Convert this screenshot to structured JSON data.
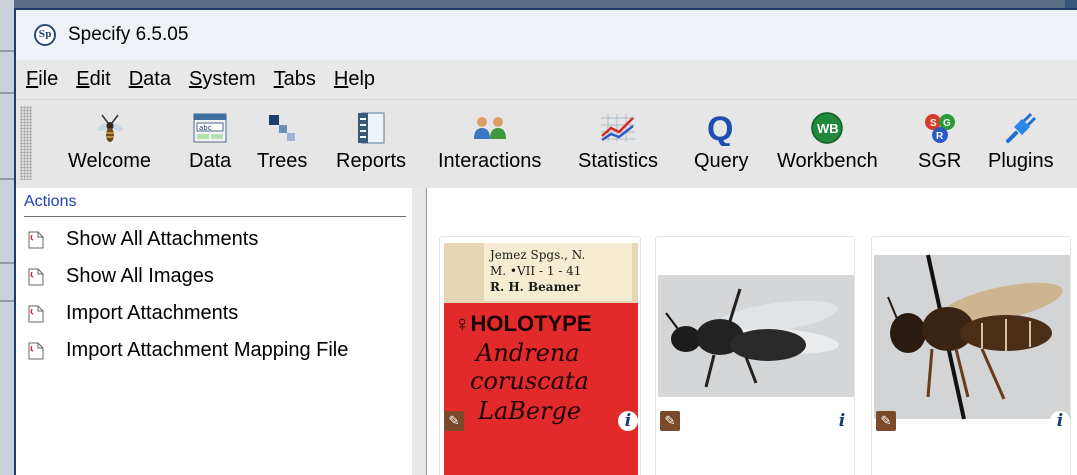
{
  "window": {
    "title": "Specify 6.5.05",
    "logo_text": "Sp"
  },
  "menu": [
    {
      "label": "File"
    },
    {
      "label": "Edit"
    },
    {
      "label": "Data"
    },
    {
      "label": "System"
    },
    {
      "label": "Tabs"
    },
    {
      "label": "Help"
    }
  ],
  "toolbar": [
    {
      "label": "Welcome",
      "icon": "bee-icon"
    },
    {
      "label": "Data",
      "icon": "form-icon"
    },
    {
      "label": "Trees",
      "icon": "tree-icon"
    },
    {
      "label": "Reports",
      "icon": "report-icon"
    },
    {
      "label": "Interactions",
      "icon": "people-icon"
    },
    {
      "label": "Statistics",
      "icon": "chart-icon"
    },
    {
      "label": "Query",
      "icon": "query-icon"
    },
    {
      "label": "Workbench",
      "icon": "workbench-icon"
    },
    {
      "label": "SGR",
      "icon": "sgr-icon"
    },
    {
      "label": "Plugins",
      "icon": "plug-icon"
    }
  ],
  "icon_text": {
    "form": "abc",
    "workbench": "WB",
    "sgr_s": "S",
    "sgr_g": "G",
    "sgr_r": "R",
    "query": "Q"
  },
  "actions_panel": {
    "heading": "Actions",
    "items": [
      {
        "label": "Show All Attachments"
      },
      {
        "label": "Show All Images"
      },
      {
        "label": "Import Attachments"
      },
      {
        "label": "Import Attachment Mapping File"
      }
    ]
  },
  "thumbnails": [
    {
      "type": "label-image",
      "top_label_lines": [
        "Jemez Spgs.,  N.",
        "M.  •VII - 1 - 41",
        "R. H. Beamer"
      ],
      "red_label_lines": [
        "♀HOLOTYPE",
        "Andrena",
        "coruscata",
        "LaBerge"
      ],
      "info_badge": "i"
    },
    {
      "type": "specimen-dorsal",
      "info_badge": "i"
    },
    {
      "type": "specimen-lateral",
      "info_badge": "i"
    }
  ],
  "colors": {
    "actions_heading": "#1d3fb8",
    "window_border": "#1c3b66",
    "holotype_red": "#e22a2a"
  }
}
